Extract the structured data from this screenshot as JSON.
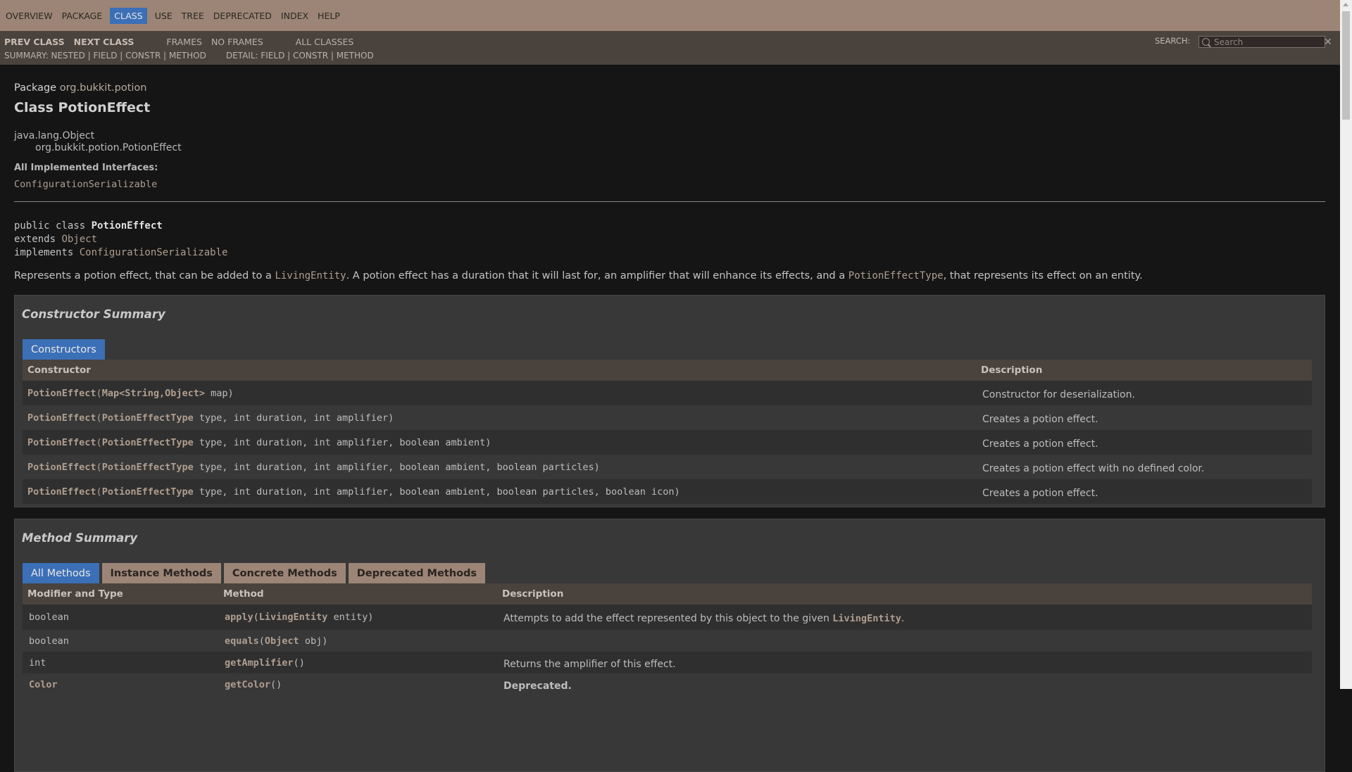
{
  "topnav": {
    "items": [
      "OVERVIEW",
      "PACKAGE",
      "CLASS",
      "USE",
      "TREE",
      "DEPRECATED",
      "INDEX",
      "HELP"
    ],
    "active": "CLASS"
  },
  "subnav": {
    "prev": "PREV CLASS",
    "next": "NEXT CLASS",
    "frames": "FRAMES",
    "no_frames": "NO FRAMES",
    "all_classes": "ALL CLASSES",
    "summary_label": "SUMMARY: NESTED | FIELD | CONSTR | METHOD",
    "detail_label": "DETAIL: FIELD | CONSTR | METHOD",
    "search_label": "SEARCH:",
    "search_placeholder": "Search"
  },
  "header": {
    "package_label": "Package",
    "package_name": "org.bukkit.potion",
    "class_title": "Class PotionEffect",
    "inheritance": [
      "java.lang.Object",
      "org.bukkit.potion.PotionEffect"
    ],
    "interfaces_label": "All Implemented Interfaces:",
    "interfaces": "ConfigurationSerializable"
  },
  "signature": {
    "line1_kw": "public class ",
    "line1_name": "PotionEffect",
    "line2_kw": "extends ",
    "line2_link": "Object",
    "line3_kw": "implements ",
    "line3_link": "ConfigurationSerializable"
  },
  "description": {
    "part1": "Represents a potion effect, that can be added to a ",
    "link1": "LivingEntity",
    "part2": ". A potion effect has a duration that it will last for, an amplifier that will enhance its effects, and a ",
    "link2": "PotionEffectType",
    "part3": ", that represents its effect on an entity."
  },
  "constructor_summary": {
    "title": "Constructor Summary",
    "tab": "Constructors",
    "col_constructor": "Constructor",
    "col_description": "Description",
    "rows": [
      {
        "name": "PotionEffect",
        "params_link": "Map<String,Object>",
        "params": " map)",
        "desc": "Constructor for deserialization."
      },
      {
        "name": "PotionEffect",
        "params_link": "PotionEffectType",
        "params": " type, int duration, int amplifier)",
        "desc": "Creates a potion effect."
      },
      {
        "name": "PotionEffect",
        "params_link": "PotionEffectType",
        "params": " type, int duration, int amplifier, boolean ambient)",
        "desc": "Creates a potion effect."
      },
      {
        "name": "PotionEffect",
        "params_link": "PotionEffectType",
        "params": " type, int duration, int amplifier, boolean ambient, boolean particles)",
        "desc": "Creates a potion effect with no defined color."
      },
      {
        "name": "PotionEffect",
        "params_link": "PotionEffectType",
        "params": " type, int duration, int amplifier, boolean ambient, boolean particles, boolean icon)",
        "desc": "Creates a potion effect."
      }
    ]
  },
  "method_summary": {
    "title": "Method Summary",
    "tabs": [
      "All Methods",
      "Instance Methods",
      "Concrete Methods",
      "Deprecated Methods"
    ],
    "col_modifier": "Modifier and Type",
    "col_method": "Method",
    "col_description": "Description",
    "rows": [
      {
        "type": "boolean",
        "method": "apply",
        "param_link": "LivingEntity",
        "param": " entity)",
        "desc_text": "Attempts to add the effect represented by this object to the given ",
        "desc_link": "LivingEntity",
        "desc_tail": "."
      },
      {
        "type": "boolean",
        "method": "equals",
        "param_link": "Object",
        "param": " obj)",
        "desc_text": "",
        "desc_link": "",
        "desc_tail": ""
      },
      {
        "type": "int",
        "method": "getAmplifier",
        "param_link": "",
        "param": ")",
        "desc_text": "Returns the amplifier of this effect.",
        "desc_link": "",
        "desc_tail": ""
      },
      {
        "type": "Color",
        "method": "getColor",
        "param_link": "",
        "param": ")",
        "desc_text": "Deprecated.",
        "desc_link": "",
        "desc_tail": ""
      }
    ]
  }
}
